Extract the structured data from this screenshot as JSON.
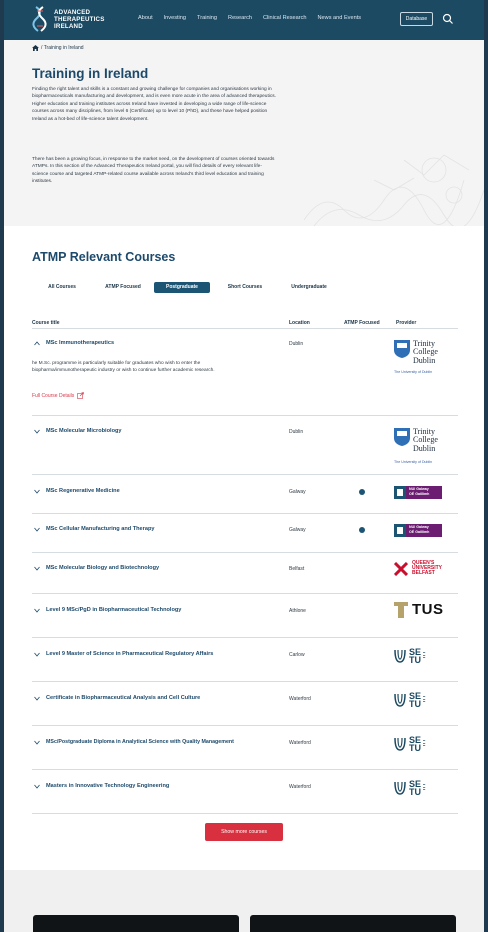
{
  "header": {
    "logo_lines": [
      "ADVANCED",
      "THERAPEUTICS",
      "IRELAND"
    ],
    "nav": [
      "About",
      "Investing",
      "Training",
      "Research",
      "Clinical Research",
      "News and Events"
    ],
    "database_label": "Database"
  },
  "breadcrumb": "/ Training in Ireland",
  "hero": {
    "title": "Training in Ireland",
    "para1": "Finding the right talent and skills is a constant and growing challenge for companies and organisations working in biopharmaceuticals manufacturing and development, and is even more acute in the area of advanced therapeutics. Higher education and training institutes across Ireland have invested in developing a wide range of life-science courses across many disciplines, from level 6 (Certificate) up to level 10 (PhD), and these have helped position Ireland as a hot-bed of life-science talent development.",
    "para2": "There has been a growing focus, in response to the market need, on the development of courses oriented towards ATMPs. In this section of the Advanced Therapeutics Ireland portal, you will find details of every relevant life-science course and targeted ATMP-related course available across Ireland's third level education and training institutes."
  },
  "courses": {
    "heading": "ATMP Relevant Courses",
    "tabs": [
      "All Courses",
      "ATMP Focused",
      "Postgraduate",
      "Short Courses",
      "Undergraduate"
    ],
    "active_tab": "Postgraduate",
    "columns": [
      "Course title",
      "Location",
      "ATMP Focused",
      "Provider"
    ],
    "expanded_description": "he M.Sc. programme is particularly suitable for graduates who wish to enter the biopharma/immunotherapeutic industry or wish to continue further academic research.",
    "full_details_label": "Full Course Details",
    "rows": [
      {
        "title": "MSc Immunotherapeutics",
        "location": "Dublin",
        "atmp": false,
        "provider": "tcd",
        "expanded": true
      },
      {
        "title": "MSc Molecular Microbiology",
        "location": "Dublin",
        "atmp": false,
        "provider": "tcd"
      },
      {
        "title": "MSc Regenerative Medicine",
        "location": "Galway",
        "atmp": true,
        "provider": "nui"
      },
      {
        "title": "MSc Cellular Manufacturing and Therapy",
        "location": "Galway",
        "atmp": true,
        "provider": "nui"
      },
      {
        "title": "MSc Molecular Biology and Biotechnology",
        "location": "Belfast",
        "atmp": false,
        "provider": "qub"
      },
      {
        "title": "Level 9 MSc/PgD in Biopharmaceutical Technology",
        "location": "Athlone",
        "atmp": false,
        "provider": "tus"
      },
      {
        "title": "Level 9 Master of Science in Pharmaceutical Regulatory Affairs",
        "location": "Carlow",
        "atmp": false,
        "provider": "setu"
      },
      {
        "title": "Certificate in Biopharmaceutical Analysis and Cell Culture",
        "location": "Waterford",
        "atmp": false,
        "provider": "setu"
      },
      {
        "title": "MSc/Postgraduate Diploma in Analytical Science with Quality Management",
        "location": "Waterford",
        "atmp": false,
        "provider": "setu"
      },
      {
        "title": "Masters in Innovative Technology Engineering",
        "location": "Waterford",
        "atmp": false,
        "provider": "setu"
      }
    ],
    "show_more_label": "Show more courses"
  },
  "providers": {
    "tcd": {
      "lines": [
        "Trinity",
        "College",
        "Dublin"
      ],
      "sub": "The University of Dublin"
    },
    "nui": {
      "lines": [
        "NUI Galway",
        "OÉ Gaillimh"
      ]
    },
    "qub": {
      "lines": [
        "QUEEN'S",
        "UNIVERSITY",
        "BELFAST"
      ]
    },
    "tus": {
      "text": "TUS"
    },
    "setu": {
      "lines": [
        "SE",
        "TU"
      ]
    }
  },
  "colors": {
    "brand_dark": "#1c4a63",
    "heading": "#1d4a6b",
    "accent_red": "#d8303f",
    "nui_purple": "#6c1d72"
  }
}
